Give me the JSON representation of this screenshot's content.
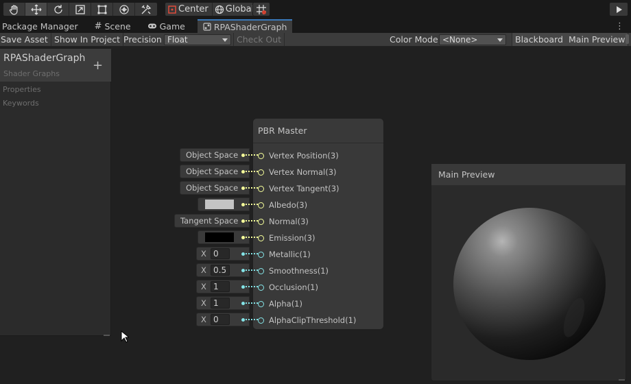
{
  "toolbar": {
    "tools": [
      "hand-icon",
      "move-icon",
      "rotate-icon",
      "scale-icon",
      "rect-icon",
      "transform-icon",
      "custom-tools-icon"
    ],
    "pivot_label": "Center",
    "space_label": "Global",
    "play_icon": "play-icon"
  },
  "tabs": [
    {
      "label": "Package Manager"
    },
    {
      "label": "Scene"
    },
    {
      "label": "Game"
    },
    {
      "label": "RPAShaderGraph"
    }
  ],
  "tab_menu_glyph": "⋮",
  "subbar": {
    "save_asset": "Save Asset",
    "show_in_project": "Show In Project",
    "precision_label": "Precision",
    "precision_value": "Float",
    "check_out": "Check Out",
    "color_mode_label": "Color Mode",
    "color_mode_value": "<None>",
    "blackboard": "Blackboard",
    "main_preview": "Main Preview"
  },
  "blackboard": {
    "title": "RPAShaderGraph",
    "subtitle": "Shader Graphs",
    "add_glyph": "+",
    "sections": [
      "Properties",
      "Keywords"
    ]
  },
  "master_node": {
    "title": "PBR Master",
    "ports": [
      {
        "label": "Vertex Position(3)",
        "kind": "vec"
      },
      {
        "label": "Vertex Normal(3)",
        "kind": "vec"
      },
      {
        "label": "Vertex Tangent(3)",
        "kind": "vec"
      },
      {
        "label": "Albedo(3)",
        "kind": "vec"
      },
      {
        "label": "Normal(3)",
        "kind": "vec"
      },
      {
        "label": "Emission(3)",
        "kind": "vec"
      },
      {
        "label": "Metallic(1)",
        "kind": "float"
      },
      {
        "label": "Smoothness(1)",
        "kind": "float"
      },
      {
        "label": "Occlusion(1)",
        "kind": "float"
      },
      {
        "label": "Alpha(1)",
        "kind": "float"
      },
      {
        "label": "AlphaClipThreshold(1)",
        "kind": "float"
      }
    ]
  },
  "inputs": {
    "vertex_position": "Object Space",
    "vertex_normal": "Object Space",
    "vertex_tangent": "Object Space",
    "albedo_color": "#c4c4c4",
    "normal_space": "Tangent Space",
    "emission_color": "#000000",
    "x_label": "X",
    "metallic": "0",
    "smoothness": "0.5",
    "occlusion": "1",
    "alpha": "1",
    "alpha_clip": "0"
  },
  "preview": {
    "title": "Main Preview"
  },
  "colors": {
    "vec_port": "#f6ff9a",
    "float_port": "#84e4e7",
    "tab_accent": "#3a79bb"
  }
}
